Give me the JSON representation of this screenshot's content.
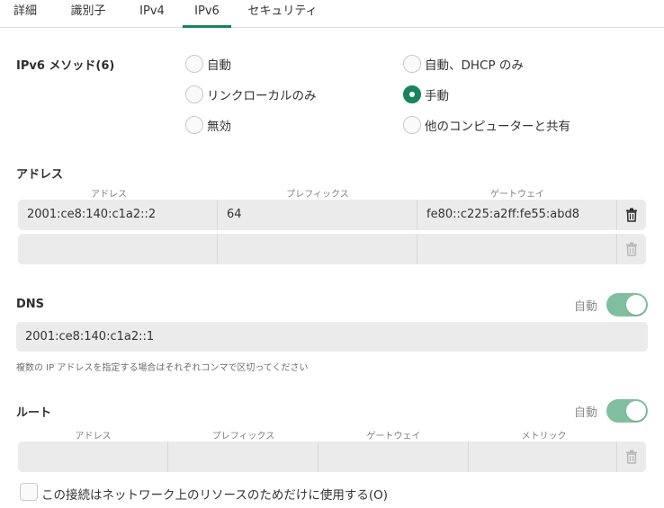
{
  "tabs": [
    {
      "label": "詳細",
      "active": false
    },
    {
      "label": "識別子",
      "active": false
    },
    {
      "label": "IPv4",
      "active": false
    },
    {
      "label": "IPv6",
      "active": true
    },
    {
      "label": "セキュリティ",
      "active": false
    }
  ],
  "method": {
    "title": "IPv6 メソッド(6)",
    "options": [
      {
        "label": "自動",
        "checked": false
      },
      {
        "label": "自動、DHCP のみ",
        "checked": false
      },
      {
        "label": "リンクローカルのみ",
        "checked": false
      },
      {
        "label": "手動",
        "checked": true
      },
      {
        "label": "無効",
        "checked": false
      },
      {
        "label": "他のコンピューターと共有",
        "checked": false
      }
    ]
  },
  "addresses": {
    "title": "アドレス",
    "headers": [
      "アドレス",
      "プレフィックス",
      "ゲートウェイ"
    ],
    "rows": [
      [
        "2001:ce8:140:c1a2::2",
        "64",
        "fe80::c225:a2ff:fe55:abd8"
      ],
      [
        "",
        "",
        ""
      ]
    ]
  },
  "dns": {
    "title": "DNS",
    "auto_label": "自動",
    "auto_on": true,
    "value": "2001:ce8:140:c1a2::1",
    "hint": "複数の IP アドレスを指定する場合はそれぞれコンマで区切ってください"
  },
  "routes": {
    "title": "ルート",
    "auto_label": "自動",
    "auto_on": true,
    "headers": [
      "アドレス",
      "プレフィックス",
      "ゲートウェイ",
      "メトリック"
    ],
    "rows": [
      [
        "",
        "",
        "",
        ""
      ]
    ]
  },
  "only_local": {
    "label": "この接続はネットワーク上のリソースのためだけに使用する(O)",
    "checked": false
  },
  "colors": {
    "accent": "#17845a",
    "toggle_on": "#7fbf9f"
  }
}
